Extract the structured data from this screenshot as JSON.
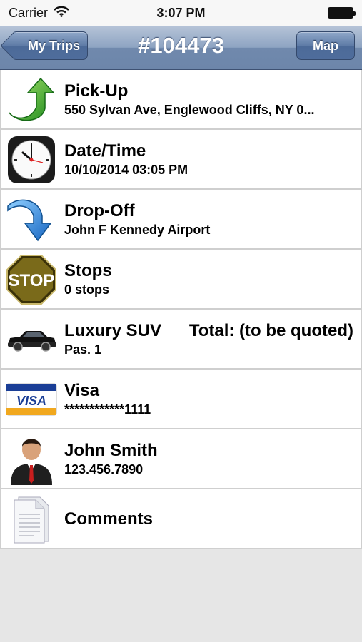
{
  "status": {
    "carrier": "Carrier",
    "time": "3:07 PM"
  },
  "nav": {
    "back_label": "My Trips",
    "title": "#104473",
    "map_label": "Map"
  },
  "rows": [
    {
      "icon": "green-arrow-icon",
      "title": "Pick-Up",
      "subtitle": "550 Sylvan Ave, Englewood Cliffs, NY 0..."
    },
    {
      "icon": "clock-icon",
      "title": "Date/Time",
      "subtitle": "10/10/2014 03:05 PM"
    },
    {
      "icon": "blue-arrow-icon",
      "title": "Drop-Off",
      "subtitle": "John F Kennedy Airport"
    },
    {
      "icon": "stop-sign-icon",
      "title": "Stops",
      "subtitle": "0 stops",
      "sign_text": "STOP"
    },
    {
      "icon": "car-icon",
      "title": "Luxury SUV",
      "total": "Total: (to be quoted)",
      "subtitle": "Pas. 1"
    },
    {
      "icon": "visa-card-icon",
      "title": "Visa",
      "subtitle": "************1111",
      "card_text": "VISA"
    },
    {
      "icon": "person-icon",
      "title": "John Smith",
      "subtitle": "123.456.7890"
    },
    {
      "icon": "document-icon",
      "title": "Comments"
    }
  ]
}
